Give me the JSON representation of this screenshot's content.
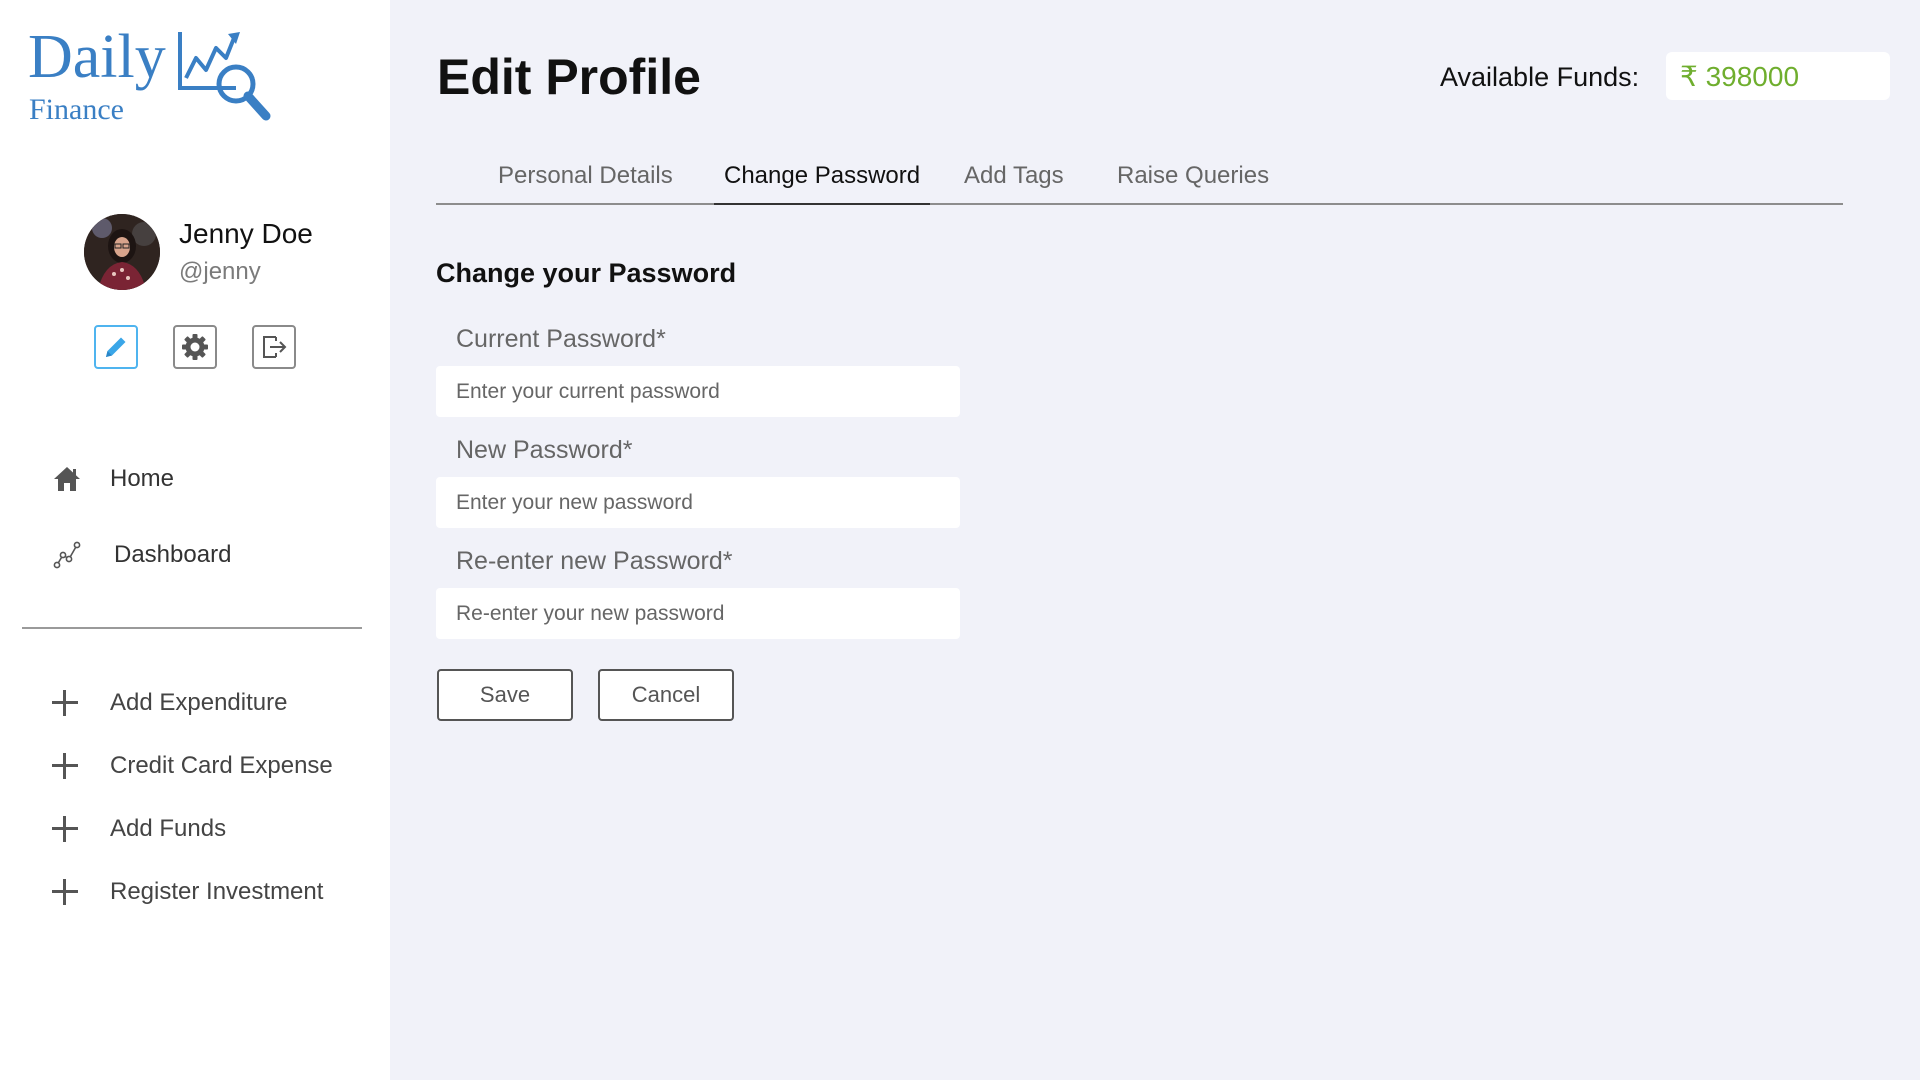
{
  "brand": {
    "name_line1": "Daily",
    "name_line2": "Finance",
    "color": "#3a7fc4"
  },
  "user": {
    "name": "Jenny Doe",
    "handle": "@jenny"
  },
  "profile_actions": [
    {
      "icon": "pencil-icon",
      "active": true
    },
    {
      "icon": "gear-icon",
      "active": false
    },
    {
      "icon": "logout-icon",
      "active": false
    }
  ],
  "nav": {
    "items": [
      {
        "label": "Home",
        "icon": "home-icon"
      },
      {
        "label": "Dashboard",
        "icon": "chart-line-icon"
      }
    ]
  },
  "actions": {
    "items": [
      {
        "label": "Add Expenditure",
        "icon": "plus-icon"
      },
      {
        "label": "Credit Card Expense",
        "icon": "plus-icon"
      },
      {
        "label": "Add Funds",
        "icon": "plus-icon"
      },
      {
        "label": "Register Investment",
        "icon": "plus-icon"
      }
    ]
  },
  "header": {
    "title": "Edit Profile",
    "funds_label": "Available Funds:",
    "funds_value": "₹ 398000",
    "funds_color": "#6fae2e"
  },
  "tabs": [
    {
      "label": "Personal Details",
      "active": false
    },
    {
      "label": "Change Password",
      "active": true
    },
    {
      "label": "Add Tags",
      "active": false
    },
    {
      "label": "Raise Queries",
      "active": false
    }
  ],
  "form": {
    "title": "Change your Password",
    "fields": [
      {
        "label": "Current Password*",
        "placeholder": "Enter your current password",
        "value": ""
      },
      {
        "label": "New Password*",
        "placeholder": "Enter your new password",
        "value": ""
      },
      {
        "label": "Re-enter new Password*",
        "placeholder": "Re-enter your new password",
        "value": ""
      }
    ],
    "save_label": "Save",
    "cancel_label": "Cancel"
  },
  "colors": {
    "background": "#f1f2f9",
    "sidebar": "#ffffff",
    "active_icon": "#4fb4ef"
  }
}
